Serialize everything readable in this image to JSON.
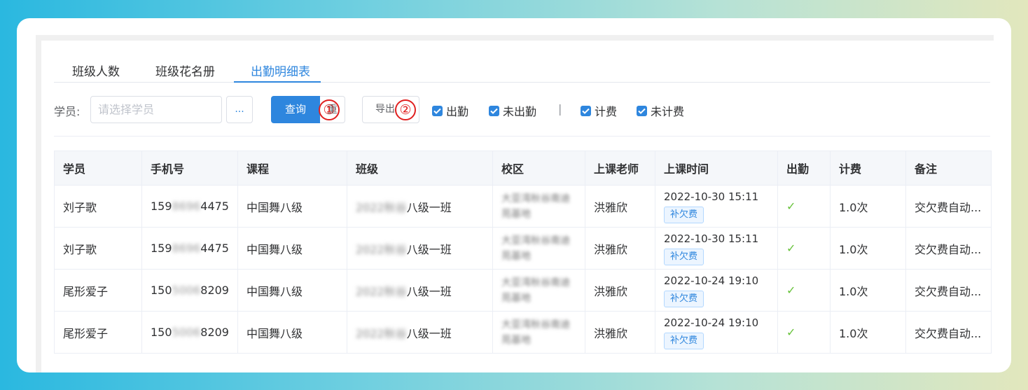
{
  "tabs": [
    {
      "label": "班级人数"
    },
    {
      "label": "班级花名册"
    },
    {
      "label": "出勤明细表"
    }
  ],
  "toolbar": {
    "student_label": "学员:",
    "student_placeholder": "请选择学员",
    "ellipsis_label": "...",
    "query_label": "查询",
    "reset_label": "重",
    "export_label": "导出",
    "callout_1": "①",
    "callout_2": "②",
    "checkboxes": [
      {
        "label": "出勤",
        "checked": true
      },
      {
        "label": "未出勤",
        "checked": true
      },
      {
        "label": "计费",
        "checked": true
      },
      {
        "label": "未计费",
        "checked": true
      }
    ],
    "separator": "|"
  },
  "table": {
    "headers": [
      "学员",
      "手机号",
      "课程",
      "班级",
      "校区",
      "上课老师",
      "上课时间",
      "出勤",
      "计费",
      "备注"
    ],
    "rows": [
      {
        "student": "刘子歌",
        "phone_pre": "159",
        "phone_mid": "8696",
        "phone_suf": "4475",
        "course": "中国舞八级",
        "class_blur": "2022秋谷",
        "class_clear": "八级一班",
        "campus": "大亚湾秋谷南迪苑基地",
        "teacher": "洪雅欣",
        "time": "2022-10-30 15:11",
        "tag": "补欠费",
        "attend": "✓",
        "fee": "1.0次",
        "note": "交欠费自动..."
      },
      {
        "student": "刘子歌",
        "phone_pre": "159",
        "phone_mid": "8696",
        "phone_suf": "4475",
        "course": "中国舞八级",
        "class_blur": "2022秋谷",
        "class_clear": "八级一班",
        "campus": "大亚湾秋谷南迪苑基地",
        "teacher": "洪雅欣",
        "time": "2022-10-30 15:11",
        "tag": "补欠费",
        "attend": "✓",
        "fee": "1.0次",
        "note": "交欠费自动..."
      },
      {
        "student": "尾形爱子",
        "phone_pre": "150",
        "phone_mid": "5006",
        "phone_suf": "8209",
        "course": "中国舞八级",
        "class_blur": "2022秋谷",
        "class_clear": "八级一班",
        "campus": "大亚湾秋谷南迪苑基地",
        "teacher": "洪雅欣",
        "time": "2022-10-24 19:10",
        "tag": "补欠费",
        "attend": "✓",
        "fee": "1.0次",
        "note": "交欠费自动..."
      },
      {
        "student": "尾形爱子",
        "phone_pre": "150",
        "phone_mid": "5006",
        "phone_suf": "8209",
        "course": "中国舞八级",
        "class_blur": "2022秋谷",
        "class_clear": "八级一班",
        "campus": "大亚湾秋谷南迪苑基地",
        "teacher": "洪雅欣",
        "time": "2022-10-24 19:10",
        "tag": "补欠费",
        "attend": "✓",
        "fee": "1.0次",
        "note": "交欠费自动..."
      }
    ]
  },
  "colors": {
    "primary": "#2e86de",
    "callout": "#e02020",
    "check": "#67c23a"
  }
}
